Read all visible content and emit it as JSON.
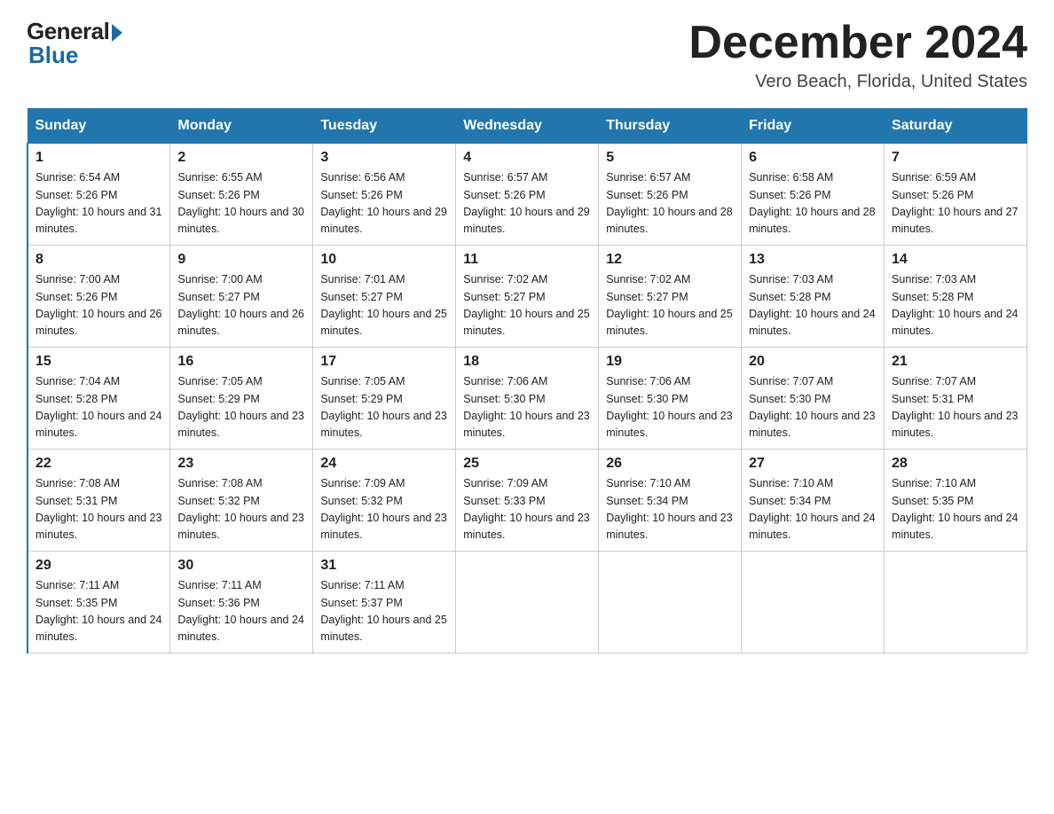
{
  "header": {
    "logo_general": "General",
    "logo_blue": "Blue",
    "title": "December 2024",
    "subtitle": "Vero Beach, Florida, United States"
  },
  "days_of_week": [
    "Sunday",
    "Monday",
    "Tuesday",
    "Wednesday",
    "Thursday",
    "Friday",
    "Saturday"
  ],
  "weeks": [
    [
      {
        "day": "1",
        "sunrise": "6:54 AM",
        "sunset": "5:26 PM",
        "daylight": "10 hours and 31 minutes."
      },
      {
        "day": "2",
        "sunrise": "6:55 AM",
        "sunset": "5:26 PM",
        "daylight": "10 hours and 30 minutes."
      },
      {
        "day": "3",
        "sunrise": "6:56 AM",
        "sunset": "5:26 PM",
        "daylight": "10 hours and 29 minutes."
      },
      {
        "day": "4",
        "sunrise": "6:57 AM",
        "sunset": "5:26 PM",
        "daylight": "10 hours and 29 minutes."
      },
      {
        "day": "5",
        "sunrise": "6:57 AM",
        "sunset": "5:26 PM",
        "daylight": "10 hours and 28 minutes."
      },
      {
        "day": "6",
        "sunrise": "6:58 AM",
        "sunset": "5:26 PM",
        "daylight": "10 hours and 28 minutes."
      },
      {
        "day": "7",
        "sunrise": "6:59 AM",
        "sunset": "5:26 PM",
        "daylight": "10 hours and 27 minutes."
      }
    ],
    [
      {
        "day": "8",
        "sunrise": "7:00 AM",
        "sunset": "5:26 PM",
        "daylight": "10 hours and 26 minutes."
      },
      {
        "day": "9",
        "sunrise": "7:00 AM",
        "sunset": "5:27 PM",
        "daylight": "10 hours and 26 minutes."
      },
      {
        "day": "10",
        "sunrise": "7:01 AM",
        "sunset": "5:27 PM",
        "daylight": "10 hours and 25 minutes."
      },
      {
        "day": "11",
        "sunrise": "7:02 AM",
        "sunset": "5:27 PM",
        "daylight": "10 hours and 25 minutes."
      },
      {
        "day": "12",
        "sunrise": "7:02 AM",
        "sunset": "5:27 PM",
        "daylight": "10 hours and 25 minutes."
      },
      {
        "day": "13",
        "sunrise": "7:03 AM",
        "sunset": "5:28 PM",
        "daylight": "10 hours and 24 minutes."
      },
      {
        "day": "14",
        "sunrise": "7:03 AM",
        "sunset": "5:28 PM",
        "daylight": "10 hours and 24 minutes."
      }
    ],
    [
      {
        "day": "15",
        "sunrise": "7:04 AM",
        "sunset": "5:28 PM",
        "daylight": "10 hours and 24 minutes."
      },
      {
        "day": "16",
        "sunrise": "7:05 AM",
        "sunset": "5:29 PM",
        "daylight": "10 hours and 23 minutes."
      },
      {
        "day": "17",
        "sunrise": "7:05 AM",
        "sunset": "5:29 PM",
        "daylight": "10 hours and 23 minutes."
      },
      {
        "day": "18",
        "sunrise": "7:06 AM",
        "sunset": "5:30 PM",
        "daylight": "10 hours and 23 minutes."
      },
      {
        "day": "19",
        "sunrise": "7:06 AM",
        "sunset": "5:30 PM",
        "daylight": "10 hours and 23 minutes."
      },
      {
        "day": "20",
        "sunrise": "7:07 AM",
        "sunset": "5:30 PM",
        "daylight": "10 hours and 23 minutes."
      },
      {
        "day": "21",
        "sunrise": "7:07 AM",
        "sunset": "5:31 PM",
        "daylight": "10 hours and 23 minutes."
      }
    ],
    [
      {
        "day": "22",
        "sunrise": "7:08 AM",
        "sunset": "5:31 PM",
        "daylight": "10 hours and 23 minutes."
      },
      {
        "day": "23",
        "sunrise": "7:08 AM",
        "sunset": "5:32 PM",
        "daylight": "10 hours and 23 minutes."
      },
      {
        "day": "24",
        "sunrise": "7:09 AM",
        "sunset": "5:32 PM",
        "daylight": "10 hours and 23 minutes."
      },
      {
        "day": "25",
        "sunrise": "7:09 AM",
        "sunset": "5:33 PM",
        "daylight": "10 hours and 23 minutes."
      },
      {
        "day": "26",
        "sunrise": "7:10 AM",
        "sunset": "5:34 PM",
        "daylight": "10 hours and 23 minutes."
      },
      {
        "day": "27",
        "sunrise": "7:10 AM",
        "sunset": "5:34 PM",
        "daylight": "10 hours and 24 minutes."
      },
      {
        "day": "28",
        "sunrise": "7:10 AM",
        "sunset": "5:35 PM",
        "daylight": "10 hours and 24 minutes."
      }
    ],
    [
      {
        "day": "29",
        "sunrise": "7:11 AM",
        "sunset": "5:35 PM",
        "daylight": "10 hours and 24 minutes."
      },
      {
        "day": "30",
        "sunrise": "7:11 AM",
        "sunset": "5:36 PM",
        "daylight": "10 hours and 24 minutes."
      },
      {
        "day": "31",
        "sunrise": "7:11 AM",
        "sunset": "5:37 PM",
        "daylight": "10 hours and 25 minutes."
      },
      null,
      null,
      null,
      null
    ]
  ]
}
